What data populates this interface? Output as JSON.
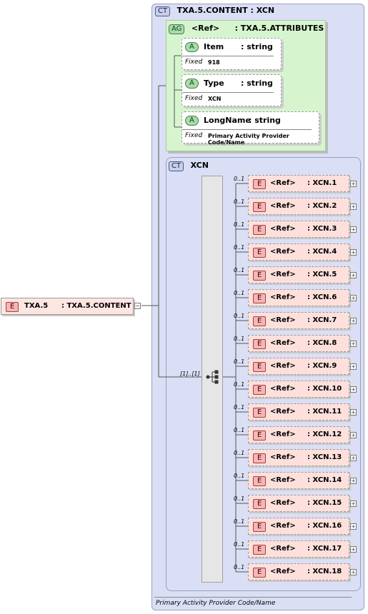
{
  "complex_type": {
    "badge": "CT",
    "title": "TXA.5.CONTENT : XCN"
  },
  "attribute_group": {
    "badge": "AG",
    "ref": "<Ref>",
    "name": ": TXA.5.ATTRIBUTES"
  },
  "attributes": [
    {
      "badge": "A",
      "name": "Item",
      "type": ": string",
      "fixed_label": "Fixed",
      "fixed_value": "918"
    },
    {
      "badge": "A",
      "name": "Type",
      "type": ": string",
      "fixed_label": "Fixed",
      "fixed_value": "XCN"
    },
    {
      "badge": "A",
      "name": "LongName",
      "type": ": string",
      "fixed_label": "Fixed",
      "fixed_value": "Primary Activity Provider Code/Name"
    }
  ],
  "xcn_type": {
    "badge": "CT",
    "title": "XCN"
  },
  "sequence_cardinality": "[1]..[1]",
  "element_cardinality": "0..1",
  "elements": [
    {
      "badge": "E",
      "ref": "<Ref>",
      "type": ": XCN.1"
    },
    {
      "badge": "E",
      "ref": "<Ref>",
      "type": ": XCN.2"
    },
    {
      "badge": "E",
      "ref": "<Ref>",
      "type": ": XCN.3"
    },
    {
      "badge": "E",
      "ref": "<Ref>",
      "type": ": XCN.4"
    },
    {
      "badge": "E",
      "ref": "<Ref>",
      "type": ": XCN.5"
    },
    {
      "badge": "E",
      "ref": "<Ref>",
      "type": ": XCN.6"
    },
    {
      "badge": "E",
      "ref": "<Ref>",
      "type": ": XCN.7"
    },
    {
      "badge": "E",
      "ref": "<Ref>",
      "type": ": XCN.8"
    },
    {
      "badge": "E",
      "ref": "<Ref>",
      "type": ": XCN.9"
    },
    {
      "badge": "E",
      "ref": "<Ref>",
      "type": ": XCN.10"
    },
    {
      "badge": "E",
      "ref": "<Ref>",
      "type": ": XCN.11"
    },
    {
      "badge": "E",
      "ref": "<Ref>",
      "type": ": XCN.12"
    },
    {
      "badge": "E",
      "ref": "<Ref>",
      "type": ": XCN.13"
    },
    {
      "badge": "E",
      "ref": "<Ref>",
      "type": ": XCN.14"
    },
    {
      "badge": "E",
      "ref": "<Ref>",
      "type": ": XCN.15"
    },
    {
      "badge": "E",
      "ref": "<Ref>",
      "type": ": XCN.16"
    },
    {
      "badge": "E",
      "ref": "<Ref>",
      "type": ": XCN.17"
    },
    {
      "badge": "E",
      "ref": "<Ref>",
      "type": ": XCN.18"
    }
  ],
  "root_element": {
    "badge": "E",
    "name": "TXA.5",
    "type": ": TXA.5.CONTENT"
  },
  "documentation": "Primary Activity Provider Code/Name",
  "colors": {
    "complex_type_bg": "#dadff5",
    "attribute_group_bg": "#d6f5cf",
    "element_bg": "#fde0dc"
  }
}
